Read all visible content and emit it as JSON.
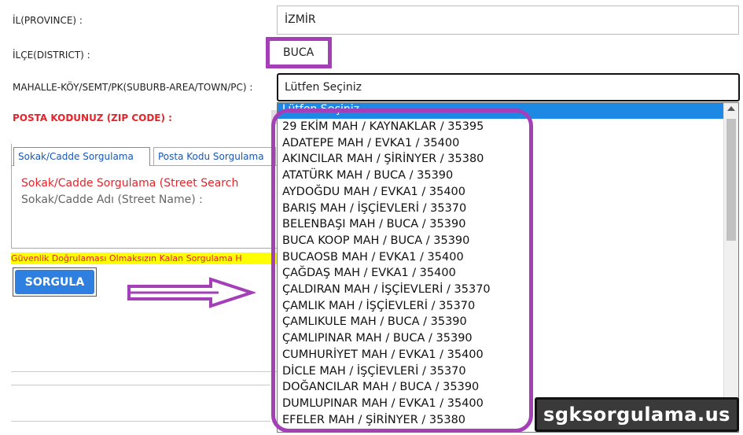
{
  "province": {
    "label": "İL(PROVINCE) :",
    "value": "İZMİR"
  },
  "district": {
    "label": "İLÇE(DISTRICT) :",
    "value": "BUCA"
  },
  "suburb": {
    "label": "MAHALLE-KÖY/SEMT/PK(SUBURB-AREA/TOWN/PC) :",
    "selected": "Lütfen Seçiniz"
  },
  "zip": {
    "label": "POSTA KODUNUZ (ZIP CODE) :"
  },
  "tabs": [
    {
      "label": "Sokak/Cadde Sorgulama"
    },
    {
      "label": "Posta Kodu Sorgulama"
    }
  ],
  "street_search": {
    "title": "Sokak/Cadde Sorgulama (Street Search",
    "field_label": "Sokak/Cadde Adı (Street Name) :"
  },
  "warning": "Güvenlik Doğrulaması Olmaksızın Kalan Sorgulama H",
  "query_button": "SORGULA",
  "dropdown": {
    "highlighted": "Lütfen Seçiniz",
    "options": [
      "29 EKİM MAH / KAYNAKLAR / 35395",
      "ADATEPE MAH / EVKA1 / 35400",
      "AKINCILAR MAH / ŞİRİNYER / 35380",
      "ATATÜRK MAH / BUCA / 35390",
      "AYDOĞDU MAH / EVKA1 / 35400",
      "BARIŞ MAH / İŞÇİEVLERİ / 35370",
      "BELENBAŞI MAH / BUCA / 35390",
      "BUCA KOOP MAH / BUCA / 35390",
      "BUCAOSB MAH / EVKA1 / 35400",
      "ÇAĞDAŞ MAH / EVKA1 / 35400",
      "ÇALDIRAN MAH / İŞÇİEVLERİ / 35370",
      "ÇAMLIK MAH / İŞÇİEVLERİ / 35370",
      "ÇAMLIKULE MAH / BUCA / 35390",
      "ÇAMLIPINAR MAH / BUCA / 35390",
      "CUMHURİYET MAH / EVKA1 / 35400",
      "DİCLE MAH / İŞÇİEVLERİ / 35370",
      "DOĞANCILAR MAH / BUCA / 35390",
      "DUMLUPINAR MAH / EVKA1 / 35400",
      "EFELER MAH / ŞİRİNYER / 35380"
    ]
  },
  "watermark": "sgksorgulama.us",
  "colors": {
    "highlight": "#a43fb8",
    "accent": "#1e88e5",
    "required": "#e4242b"
  }
}
